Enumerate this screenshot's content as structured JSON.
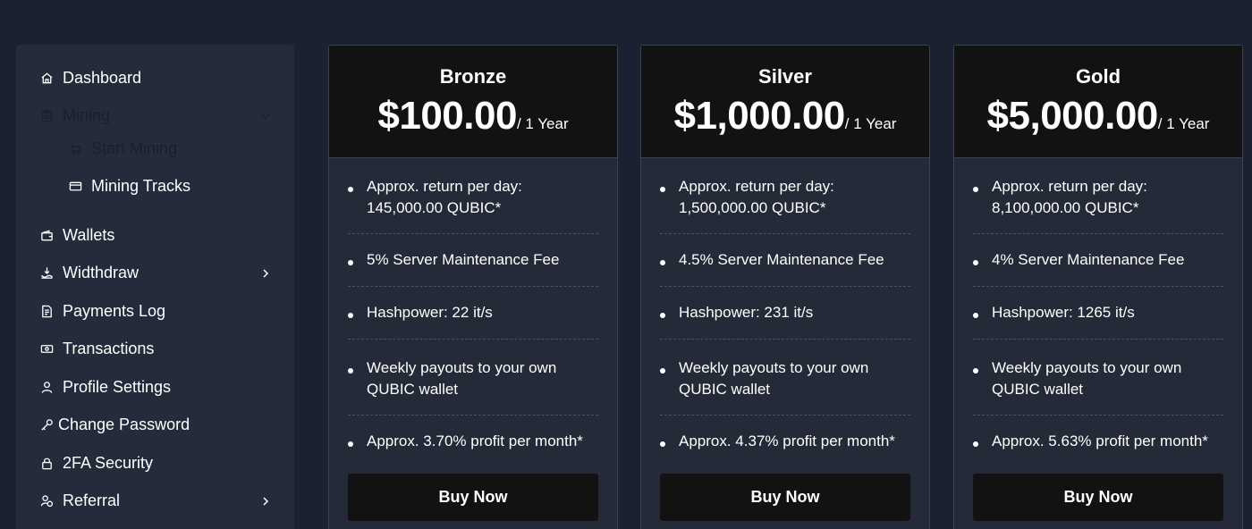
{
  "sidebar": {
    "items": [
      {
        "label": "Dashboard",
        "icon": "home-icon"
      },
      {
        "label": "Mining",
        "icon": "clipboard-icon"
      },
      {
        "label": "Start Mining",
        "icon": "cart-icon"
      },
      {
        "label": "Mining Tracks",
        "icon": "card-icon"
      },
      {
        "label": "Wallets",
        "icon": "wallet-icon"
      },
      {
        "label": "Widthdraw",
        "icon": "withdraw-icon"
      },
      {
        "label": "Payments Log",
        "icon": "receipt-icon"
      },
      {
        "label": "Transactions",
        "icon": "money-icon"
      },
      {
        "label": "Profile Settings",
        "icon": "user-icon"
      },
      {
        "label": "Change Password",
        "icon": "key-icon"
      },
      {
        "label": "2FA Security",
        "icon": "lock-icon"
      },
      {
        "label": "Referral",
        "icon": "referral-icon"
      }
    ]
  },
  "plans": [
    {
      "name": "Bronze",
      "price": "$100.00",
      "period": "/ 1 Year",
      "features": [
        "Approx. return per day: 145,000.00 QUBIC*",
        "5% Server Maintenance Fee",
        "Hashpower: 22 it/s",
        "Weekly payouts to your own QUBIC wallet",
        "Approx. 3.70% profit per month*"
      ],
      "button": "Buy Now"
    },
    {
      "name": "Silver",
      "price": "$1,000.00",
      "period": "/ 1 Year",
      "features": [
        "Approx. return per day: 1,500,000.00 QUBIC*",
        "4.5% Server Maintenance Fee",
        "Hashpower: 231 it/s",
        "Weekly payouts to your own QUBIC wallet",
        "Approx. 4.37% profit per month*"
      ],
      "button": "Buy Now"
    },
    {
      "name": "Gold",
      "price": "$5,000.00",
      "period": "/ 1 Year",
      "features": [
        "Approx. return per day: 8,100,000.00 QUBIC*",
        "4% Server Maintenance Fee",
        "Hashpower: 1265 it/s",
        "Weekly payouts to your own QUBIC wallet",
        "Approx. 5.63% profit per month*"
      ],
      "button": "Buy Now"
    }
  ],
  "colors": {
    "page_bg": "#1b2130",
    "panel_bg": "#242b3b",
    "header_bg": "#121212",
    "text": "#ffffff"
  }
}
